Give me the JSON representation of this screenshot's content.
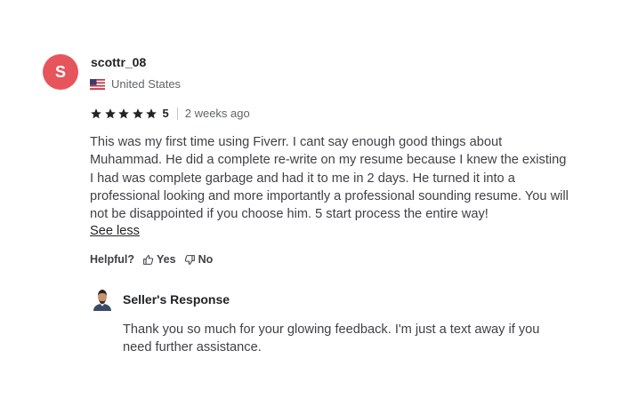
{
  "reviewer": {
    "initial": "S",
    "username": "scottr_08",
    "country": "United States",
    "avatar_color": "#e7555c"
  },
  "rating": {
    "stars": 5,
    "value": "5",
    "time_ago": "2 weeks ago",
    "icon": "star-icon"
  },
  "review": {
    "text": "This was my first time using Fiverr. I cant say enough good things about Muhammad. He did a complete re-write on my resume because I knew the existing I had was complete garbage and had it to me in 2 days. He turned it into a professional looking and more importantly a professional sounding resume. You will not be disappointed if you choose him. 5 start process the entire way!",
    "see_less_label": "See less"
  },
  "helpful": {
    "label": "Helpful?",
    "yes_label": "Yes",
    "no_label": "No"
  },
  "seller_response": {
    "title": "Seller's Response",
    "text": "Thank you so much for your glowing feedback. I'm just a text away if you need further assistance."
  }
}
